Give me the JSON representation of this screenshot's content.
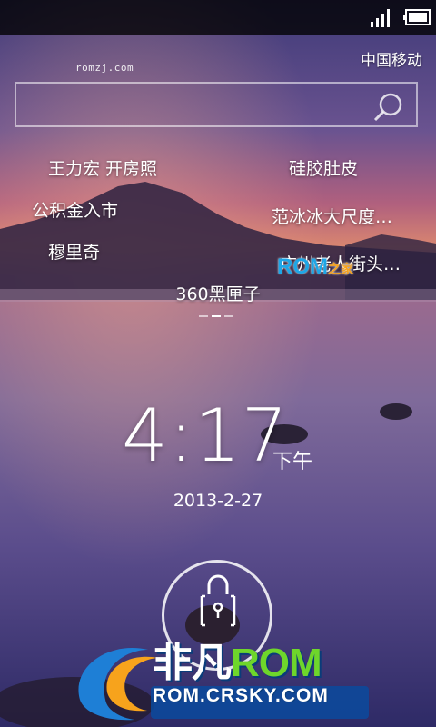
{
  "status_bar": {
    "signal_icon": "signal-bars-icon",
    "battery_icon": "battery-icon"
  },
  "carrier": "中国移动",
  "watermark_top": "romzj.com",
  "search": {
    "icon": "search-icon",
    "placeholder": ""
  },
  "hot_words": {
    "left": [
      "王力宏 开房照",
      "公积金入市",
      "穆里奇"
    ],
    "right": [
      "硅胶肚皮",
      "范冰冰大尺度…",
      "广州老人街头…"
    ],
    "center": "360黑匣子"
  },
  "rom_badge": {
    "main": "ROM",
    "sub": "之家"
  },
  "clock": {
    "time": "4:17",
    "ampm": "下午",
    "date": "2013-2-27"
  },
  "unlock": {
    "icon": "lock-icon"
  },
  "brand": {
    "name_cn": "非凡",
    "name_rom": "ROM",
    "url": "ROM.CRSKY.COM"
  },
  "colors": {
    "rom_badge": "#1ea6e6",
    "brand_rom": "#6ed62b",
    "brand_logo_orange": "#f7a31c"
  }
}
